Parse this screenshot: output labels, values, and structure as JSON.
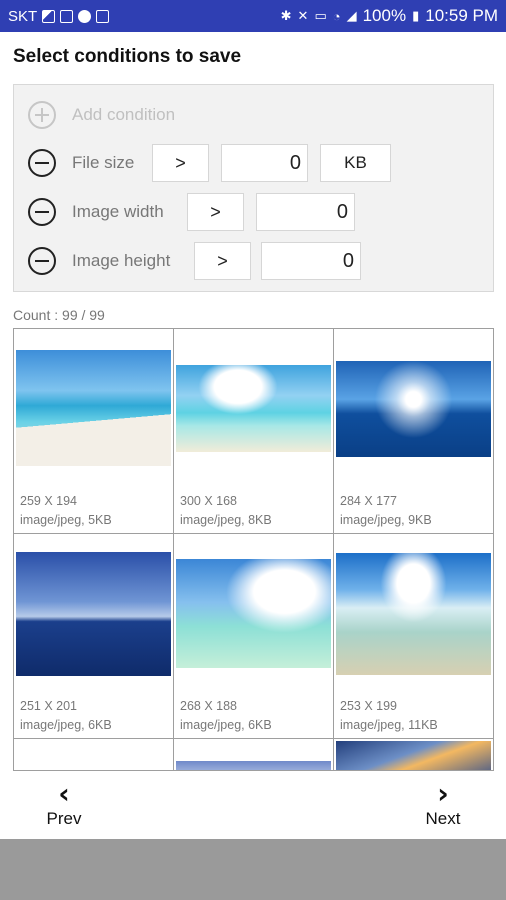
{
  "status_bar": {
    "carrier": "SKT",
    "icons_left": [
      "gallery-icon",
      "image-icon",
      "whatsapp-icon",
      "app-icon"
    ],
    "icons_right": [
      "bluetooth-icon",
      "mute-icon",
      "hd-icon",
      "wifi-icon",
      "signal-icon"
    ],
    "battery": "100%",
    "time": "10:59 PM",
    "background": "#2f3fb3"
  },
  "title": "Select conditions to save",
  "conditions": {
    "add_label": "Add condition",
    "rows": [
      {
        "label": "File size",
        "operator": ">",
        "value": "0",
        "unit": "KB"
      },
      {
        "label": "Image width",
        "operator": ">",
        "value": "0"
      },
      {
        "label": "Image height",
        "operator": ">",
        "value": "0"
      }
    ]
  },
  "count_text": "Count : 99 / 99",
  "images": [
    {
      "dims": "259 X 194",
      "type": "image/jpeg, 5KB"
    },
    {
      "dims": "300 X 168",
      "type": "image/jpeg, 8KB"
    },
    {
      "dims": "284 X 177",
      "type": "image/jpeg, 9KB"
    },
    {
      "dims": "251 X 201",
      "type": "image/jpeg, 6KB"
    },
    {
      "dims": "268 X 188",
      "type": "image/jpeg, 6KB"
    },
    {
      "dims": "253 X 199",
      "type": "image/jpeg, 11KB"
    }
  ],
  "nav": {
    "prev_label": "Prev",
    "next_label": "Next",
    "prev_icon": "chevron-left-icon",
    "next_icon": "chevron-right-icon"
  }
}
